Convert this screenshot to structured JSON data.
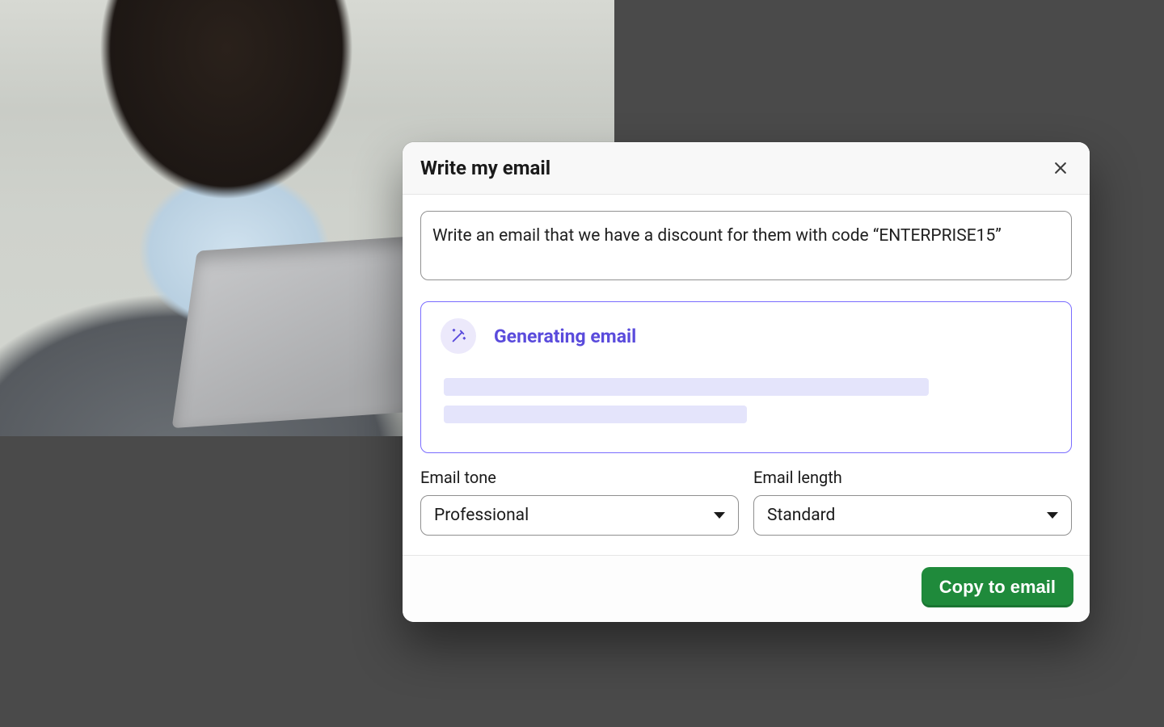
{
  "modal": {
    "title": "Write my email",
    "close_icon": "close-icon",
    "prompt": {
      "value": "Write an email that we have a discount for them with code “ENTERPRISE15”"
    },
    "generating": {
      "icon": "magic-wand-icon",
      "label": "Generating email"
    },
    "tone": {
      "label": "Email tone",
      "value": "Professional"
    },
    "length": {
      "label": "Email length",
      "value": "Standard"
    },
    "footer": {
      "primary_button": "Copy to email"
    }
  },
  "colors": {
    "accent_purple": "#5a4bdc",
    "accent_green": "#1f8a3b"
  }
}
